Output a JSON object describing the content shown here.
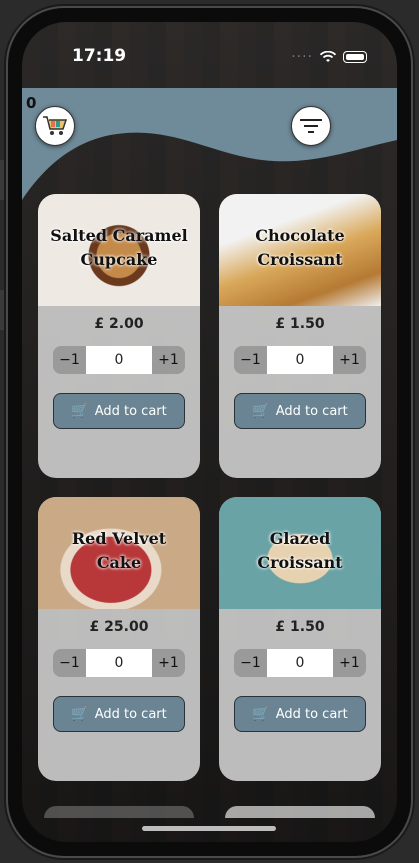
{
  "status_bar": {
    "time": "17:19"
  },
  "header": {
    "cart_count": "0"
  },
  "products": [
    {
      "title_line1": "Salted Caramel",
      "title_line2": "Cupcake",
      "price": "£ 2.00",
      "qty": "0",
      "minus": "−1",
      "plus": "+1",
      "add_label": "Add to cart"
    },
    {
      "title_line1": "Chocolate",
      "title_line2": "Croissant",
      "price": "£ 1.50",
      "qty": "0",
      "minus": "−1",
      "plus": "+1",
      "add_label": "Add to cart"
    },
    {
      "title_line1": "Red Velvet",
      "title_line2": "Cake",
      "price": "£ 25.00",
      "qty": "0",
      "minus": "−1",
      "plus": "+1",
      "add_label": "Add to cart"
    },
    {
      "title_line1": "Glazed",
      "title_line2": "Croissant",
      "price": "£ 1.50",
      "qty": "0",
      "minus": "−1",
      "plus": "+1",
      "add_label": "Add to cart"
    }
  ],
  "colors": {
    "header": "#6f8a99",
    "button": "#6a8493"
  }
}
